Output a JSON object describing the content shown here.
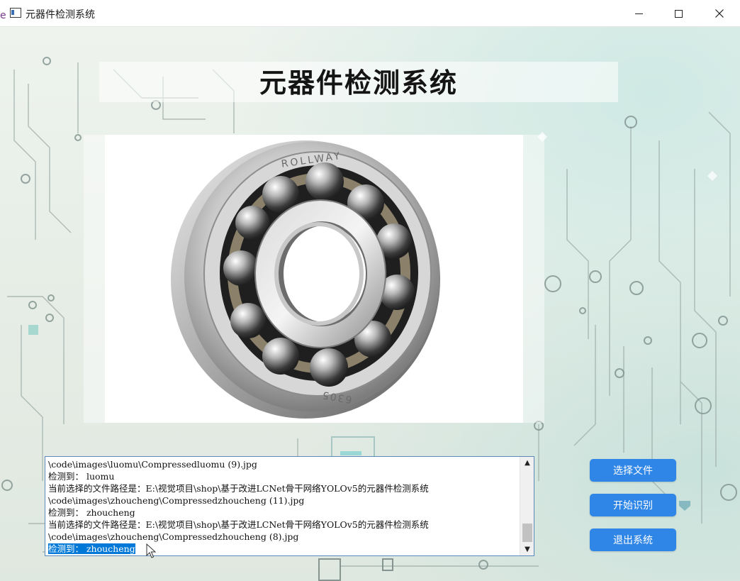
{
  "window": {
    "title": "元器件检测系统"
  },
  "header": {
    "title": "元器件检测系统"
  },
  "image_panel": {
    "icon": "bearing-image",
    "brand_text_top": "ROLLWAY",
    "brand_text_bottom": "6305"
  },
  "log": {
    "lines": [
      "\\code\\images\\luomu\\Compressedluomu (9).jpg",
      "检测到： luomu",
      "当前选择的文件路径是：E:\\视觉项目\\shop\\基于改进LCNet骨干网络YOLOv5的元器件检测系统",
      "\\code\\images\\zhoucheng\\Compressedzhoucheng (11).jpg",
      "检测到： zhoucheng",
      "当前选择的文件路径是：E:\\视觉项目\\shop\\基于改进LCNet骨干网络YOLOv5的元器件检测系统",
      "\\code\\images\\zhoucheng\\Compressedzhoucheng (8).jpg",
      "检测到： zhoucheng"
    ]
  },
  "buttons": {
    "select_file": "选择文件",
    "start_detect": "开始识别",
    "exit": "退出系统"
  },
  "colors": {
    "button_bg": "#2f86e6",
    "selection": "#0078d7",
    "log_border": "#5b87b9"
  }
}
